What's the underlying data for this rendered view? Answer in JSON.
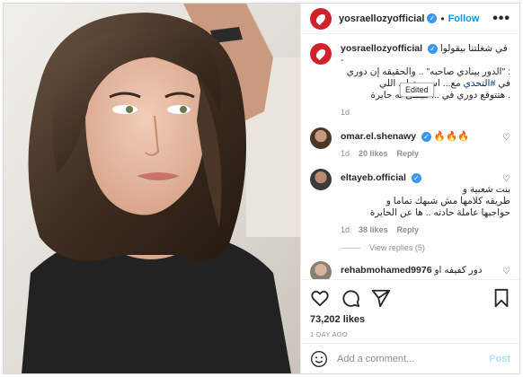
{
  "header": {
    "username": "yosraellozyofficial",
    "separator": "•",
    "follow_label": "Follow",
    "more_label": "•••"
  },
  "caption": {
    "username": "yosraellozyofficial",
    "line1": "في شغلتنا بيقولوا -",
    "line2": ": \"الدور بينادي صاحبه\" .. والحقيقه إن دوري",
    "line3_pre": "في ",
    "hashtag": "#التحدي",
    "line3_post": " مع... اس بعتها .. اللي",
    "line4": ". هتتوقع دوري في ... هبتقى له حايرة",
    "time": "1d",
    "tooltip": "Edited"
  },
  "comments": [
    {
      "username": "omar.el.shenawy",
      "text": "🔥🔥🔥",
      "time": "1d",
      "likes": "20 likes",
      "reply": "Reply"
    },
    {
      "username": "eltayeb.official",
      "text_line1": "بنت شعبية و",
      "text_line2": "طريقه كلامها مش شبهك تماما و",
      "text_line3": "حواجبها عاملة حادثه .. ها عن الحايرة",
      "time": "1d",
      "likes": "38 likes",
      "reply": "Reply",
      "view_replies": "View replies (5)"
    },
    {
      "username": "rehabmohamed9976",
      "text": "دور كفيفه او"
    }
  ],
  "actions": {
    "likes": "73,202 likes",
    "time_ago": "1 DAY AGO"
  },
  "add_comment": {
    "placeholder": "Add a comment...",
    "post_label": "Post"
  },
  "colors": {
    "accent": "#0095f6",
    "brand_red": "#d1212b",
    "verified": "#3897f0"
  }
}
